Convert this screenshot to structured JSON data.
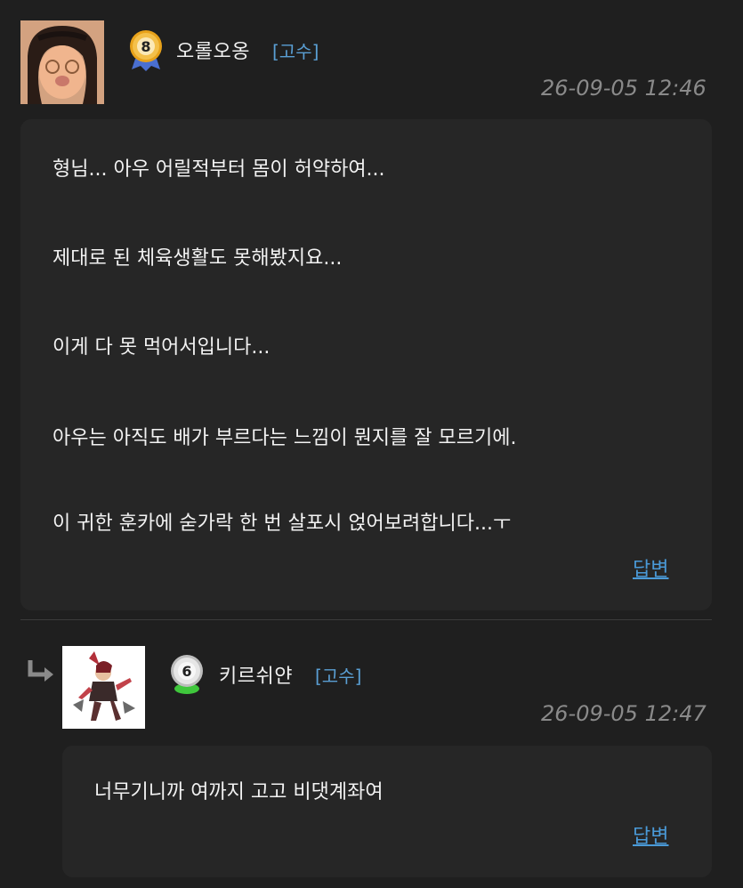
{
  "comments": [
    {
      "avatar_icon": "face-avatar-icon",
      "level": "8",
      "username": "오롤오옹",
      "rank": "[고수]",
      "timestamp": "26-09-05 12:46",
      "lines": [
        "형님... 아우 어릴적부터 몸이 허약하여...",
        "제대로 된 체육생활도 못해봤지요...",
        "이게 다 못 먹어서입니다...",
        "아우는 아직도 배가 부르다는 느낌이 뭔지를 잘 모르기에.",
        "이 귀한 훈카에 숟가락 한 번 살포시 얹어보려합니다...ㅜ"
      ],
      "reply_label": "답변"
    },
    {
      "avatar_icon": "character-avatar-icon",
      "level": "6",
      "username": "키르쉬얀",
      "rank": "[고수]",
      "timestamp": "26-09-05 12:47",
      "lines": [
        "너무기니까 여까지 고고 비댓계좌여"
      ],
      "reply_label": "답변"
    }
  ],
  "colors": {
    "background": "#1f1f1f",
    "bubble": "#262626",
    "rank": "#5a9fd4",
    "link": "#4a9ad8",
    "timestamp": "#8a8a8a",
    "badge_gold": "#e8a21a",
    "badge_silver": "#d9d9d9"
  }
}
